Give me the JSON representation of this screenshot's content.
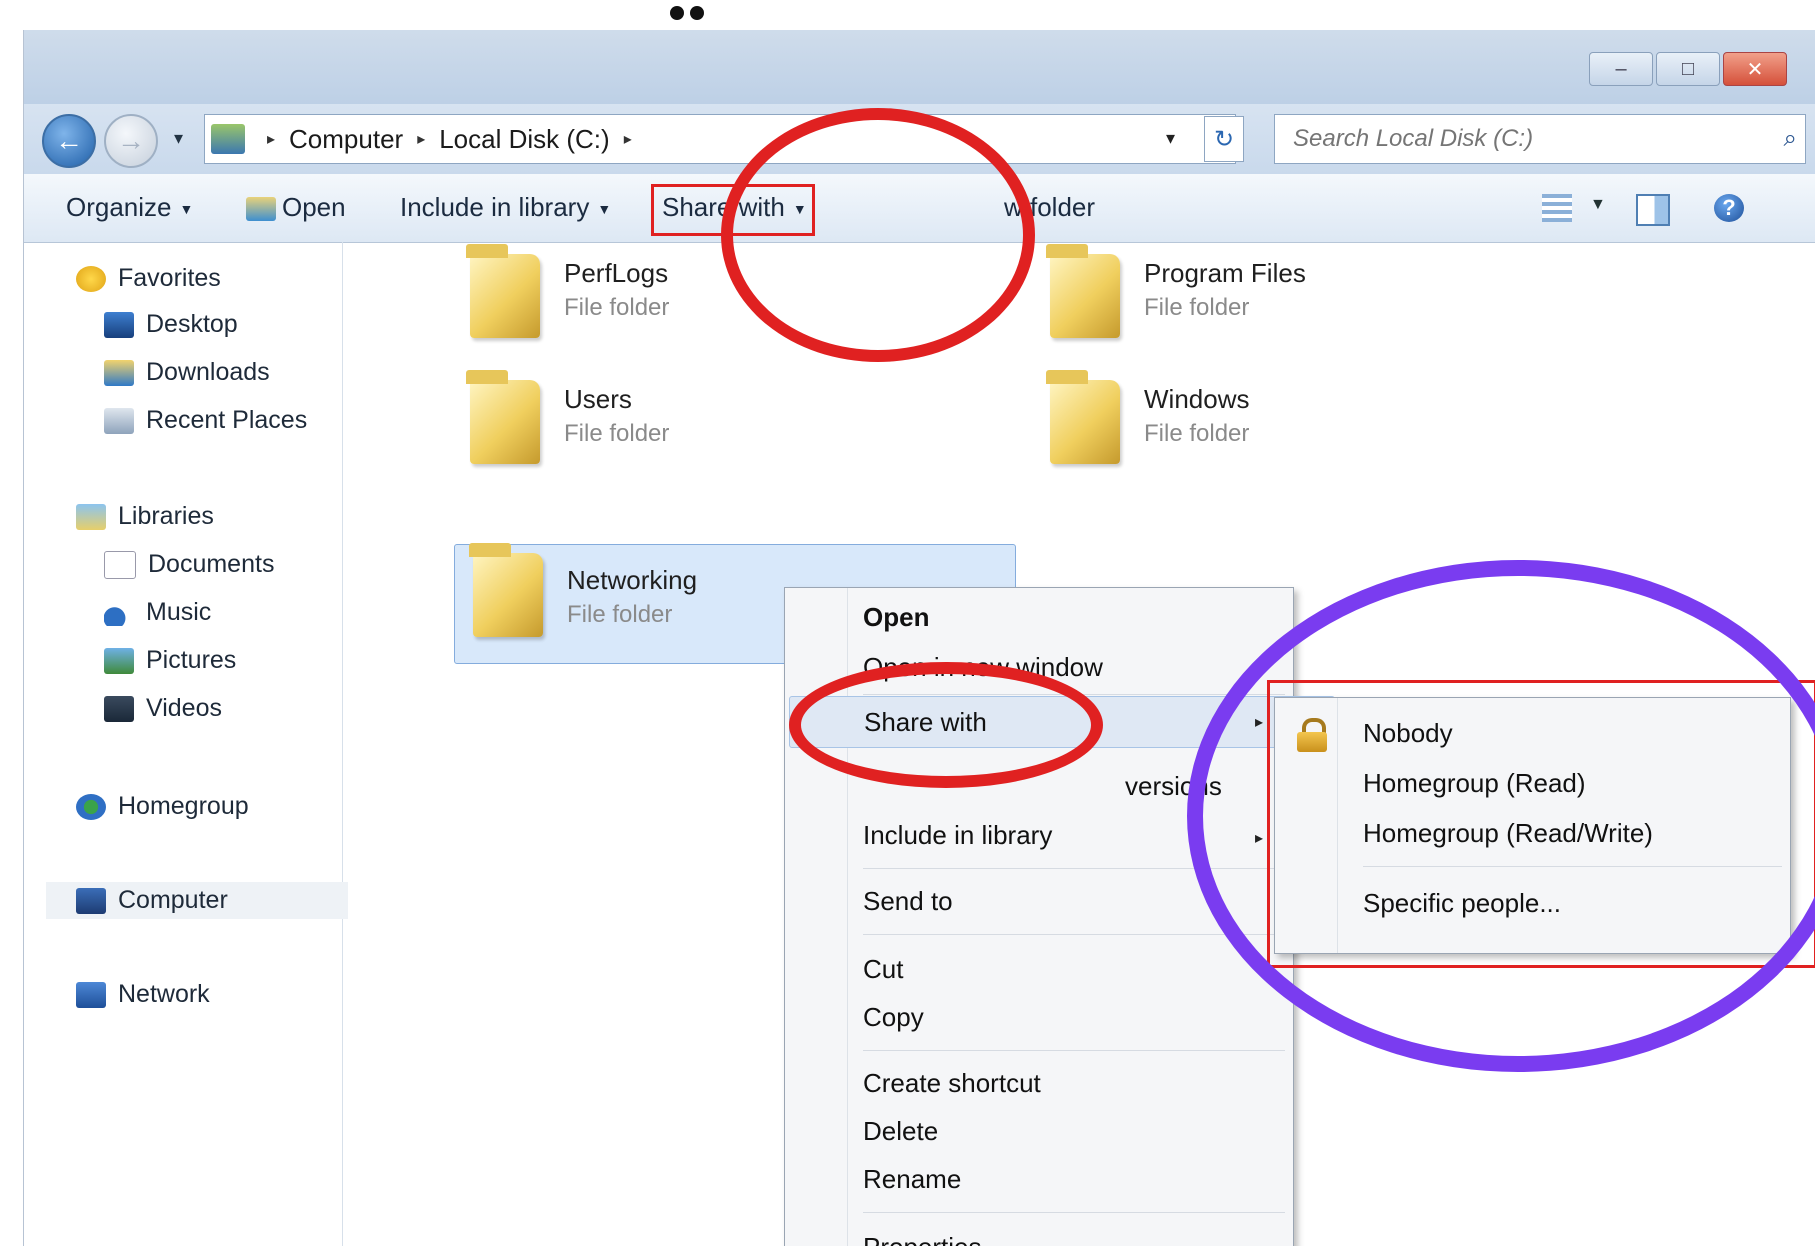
{
  "window": {
    "controls": {
      "minimize": "–",
      "maximize": "□",
      "close": "✕"
    }
  },
  "address": {
    "back": "←",
    "forward": "→",
    "crumbs": [
      "Computer",
      "Local Disk (C:)"
    ],
    "separator": "▸",
    "dropdown": "▾",
    "refresh": "↻",
    "search_placeholder": "Search Local Disk (C:)",
    "search_icon": "⌕"
  },
  "toolbar": {
    "organize": "Organize",
    "open": "Open",
    "include_in_library": "Include in library",
    "share_with": "Share with",
    "new_folder": "w folder",
    "dropdown_arrow": "▼",
    "help": "?"
  },
  "sidebar": {
    "favorites": "Favorites",
    "desktop": "Desktop",
    "downloads": "Downloads",
    "recent_places": "Recent Places",
    "libraries": "Libraries",
    "documents": "Documents",
    "music": "Music",
    "pictures": "Pictures",
    "videos": "Videos",
    "homegroup": "Homegroup",
    "computer": "Computer",
    "network": "Network"
  },
  "folders": [
    {
      "name": "PerfLogs",
      "type": "File folder"
    },
    {
      "name": "Program Files",
      "type": "File folder"
    },
    {
      "name": "Users",
      "type": "File folder"
    },
    {
      "name": "Windows",
      "type": "File folder"
    },
    {
      "name": "Networking",
      "type": "File folder"
    }
  ],
  "context_menu": {
    "open": "Open",
    "open_new_window": "Open in new window",
    "share_with": "Share with",
    "restore_versions": "versions",
    "include_in_library": "Include in library",
    "send_to": "Send to",
    "cut": "Cut",
    "copy": "Copy",
    "create_shortcut": "Create shortcut",
    "delete": "Delete",
    "rename": "Rename",
    "properties": "Properties",
    "submenu_arrow": "▸"
  },
  "share_submenu": {
    "nobody": "Nobody",
    "homegroup_read": "Homegroup (Read)",
    "homegroup_read_write": "Homegroup (Read/Write)",
    "specific_people": "Specific people..."
  },
  "colors": {
    "annotation_red": "#e02121",
    "annotation_purple": "#7a3cf0",
    "selection": "#d8e8fa"
  }
}
